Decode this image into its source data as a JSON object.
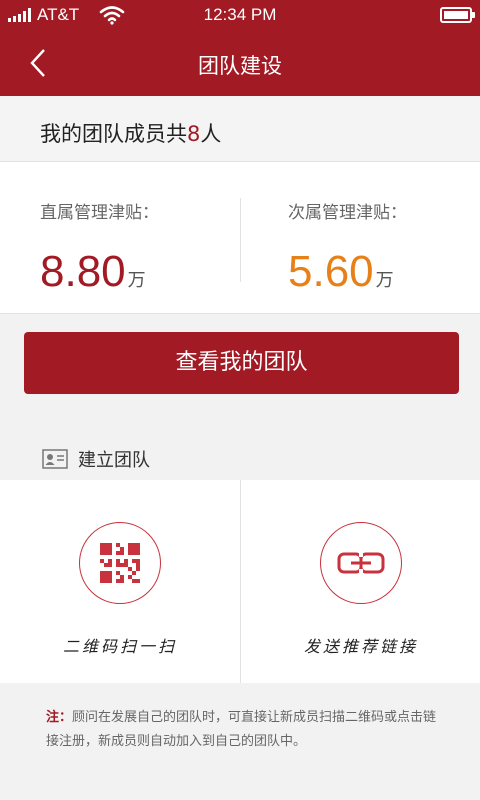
{
  "status_bar": {
    "carrier": "AT&T",
    "time": "12:34 PM",
    "icons": [
      "signal-icon",
      "wifi-icon",
      "battery-icon"
    ]
  },
  "nav": {
    "title": "团队建设",
    "back_icon": "chevron-left-icon"
  },
  "member_summary": {
    "prefix": "我的团队成员共",
    "count": "8",
    "suffix": "人"
  },
  "subsidies": {
    "direct": {
      "label": "直属管理津贴：",
      "value": "8.80",
      "unit": "万"
    },
    "secondary": {
      "label": "次属管理津贴：",
      "value": "5.60",
      "unit": "万"
    }
  },
  "view_team_button": "查看我的团队",
  "build_team": {
    "title": "建立团队",
    "icon": "id-card-icon",
    "options": [
      {
        "label": "二维码扫一扫",
        "icon": "qr-code-icon"
      },
      {
        "label": "发送推荐链接",
        "icon": "link-icon"
      }
    ]
  },
  "note": {
    "prefix": "注：",
    "text": "顾问在发展自己的团队时，可直接让新成员扫描二维码或点击链接注册，新成员则自动加入到自己的团队中。"
  },
  "colors": {
    "primary": "#a11a24",
    "secondary_value": "#e8801a",
    "background": "#f2f2f2"
  }
}
